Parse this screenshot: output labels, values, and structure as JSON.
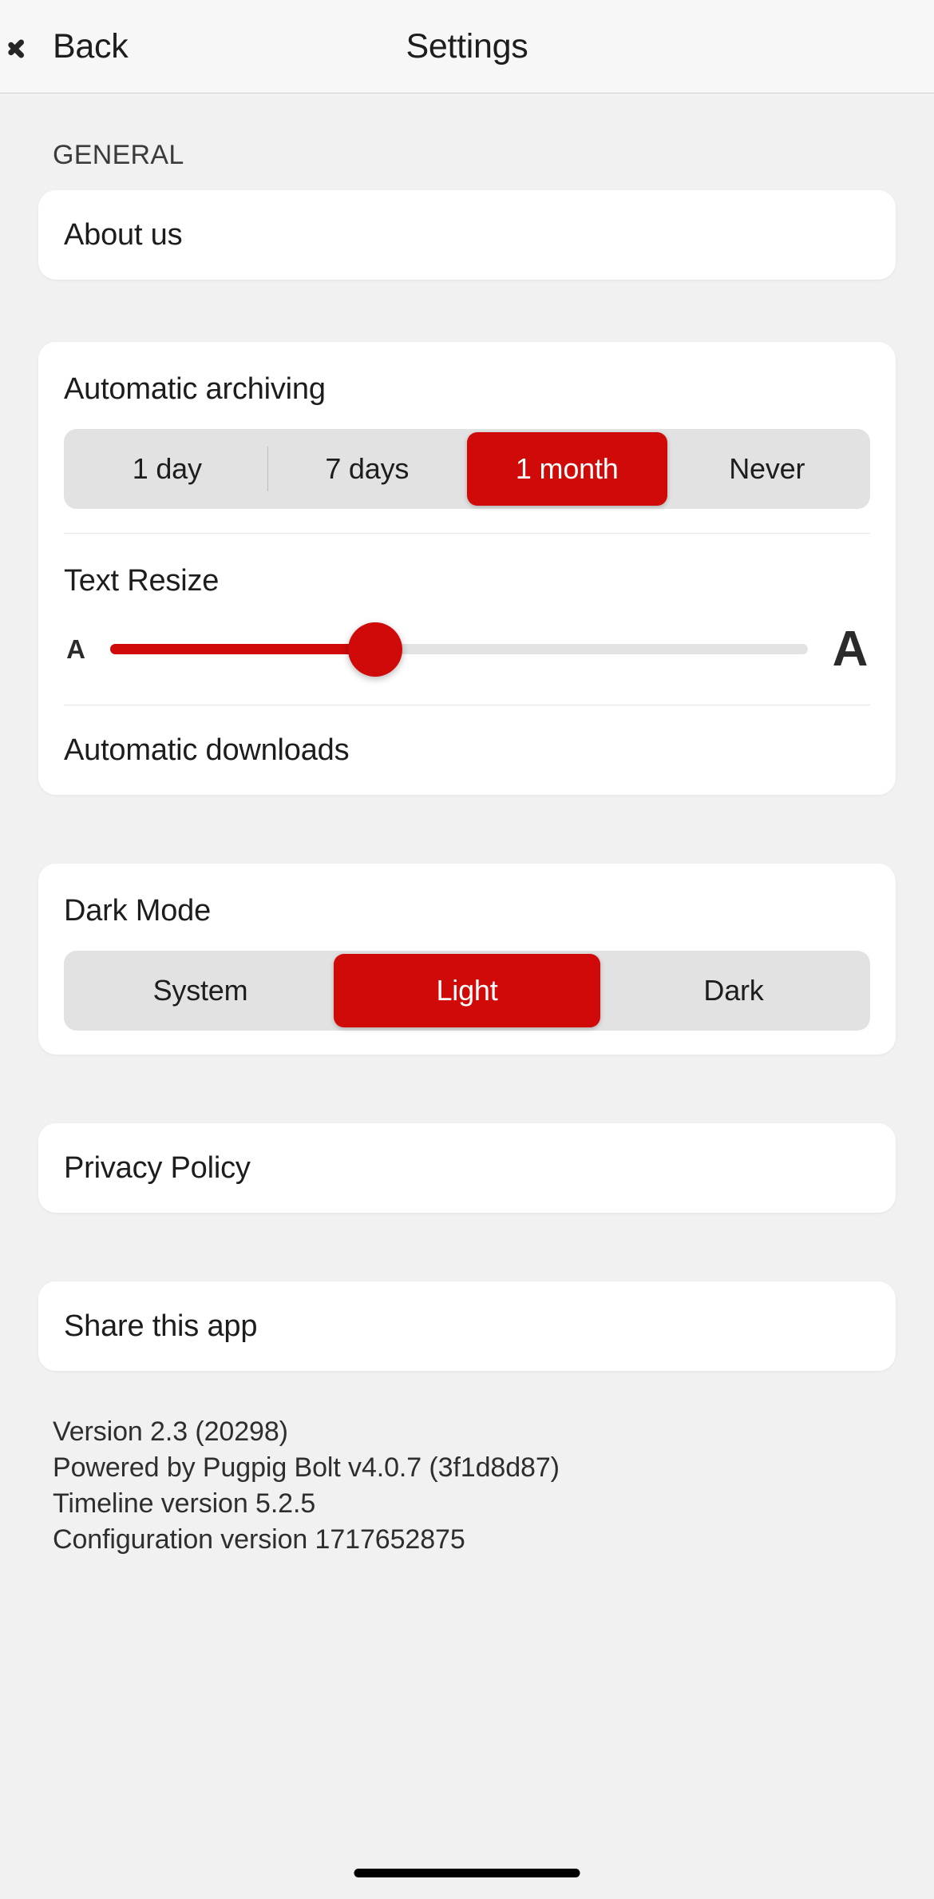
{
  "navbar": {
    "back_label": "Back",
    "title": "Settings"
  },
  "general": {
    "section_header": "GENERAL",
    "about_us": "About us"
  },
  "archiving": {
    "title": "Automatic archiving",
    "options": [
      {
        "label": "1 day",
        "selected": false
      },
      {
        "label": "7 days",
        "selected": false
      },
      {
        "label": "1 month",
        "selected": true
      },
      {
        "label": "Never",
        "selected": false
      }
    ]
  },
  "text_resize": {
    "title": "Text Resize",
    "min_label": "A",
    "max_label": "A",
    "value_percent": 38
  },
  "automatic_downloads": {
    "label": "Automatic downloads"
  },
  "dark_mode": {
    "title": "Dark Mode",
    "options": [
      {
        "label": "System",
        "selected": false
      },
      {
        "label": "Light",
        "selected": true
      },
      {
        "label": "Dark",
        "selected": false
      }
    ]
  },
  "privacy_policy": {
    "label": "Privacy Policy"
  },
  "share": {
    "label": "Share this app"
  },
  "version_info": {
    "app_version": "Version 2.3 (20298)",
    "powered_by": "Powered by Pugpig Bolt v4.0.7 (3f1d8d87)",
    "timeline_version": "Timeline version 5.2.5",
    "configuration_version": "Configuration version 1717652875"
  },
  "colors": {
    "accent": "#d00909",
    "background": "#f1f1f1",
    "card": "#ffffff",
    "segment_track": "#e2e2e2",
    "text": "#1d1d1d"
  }
}
